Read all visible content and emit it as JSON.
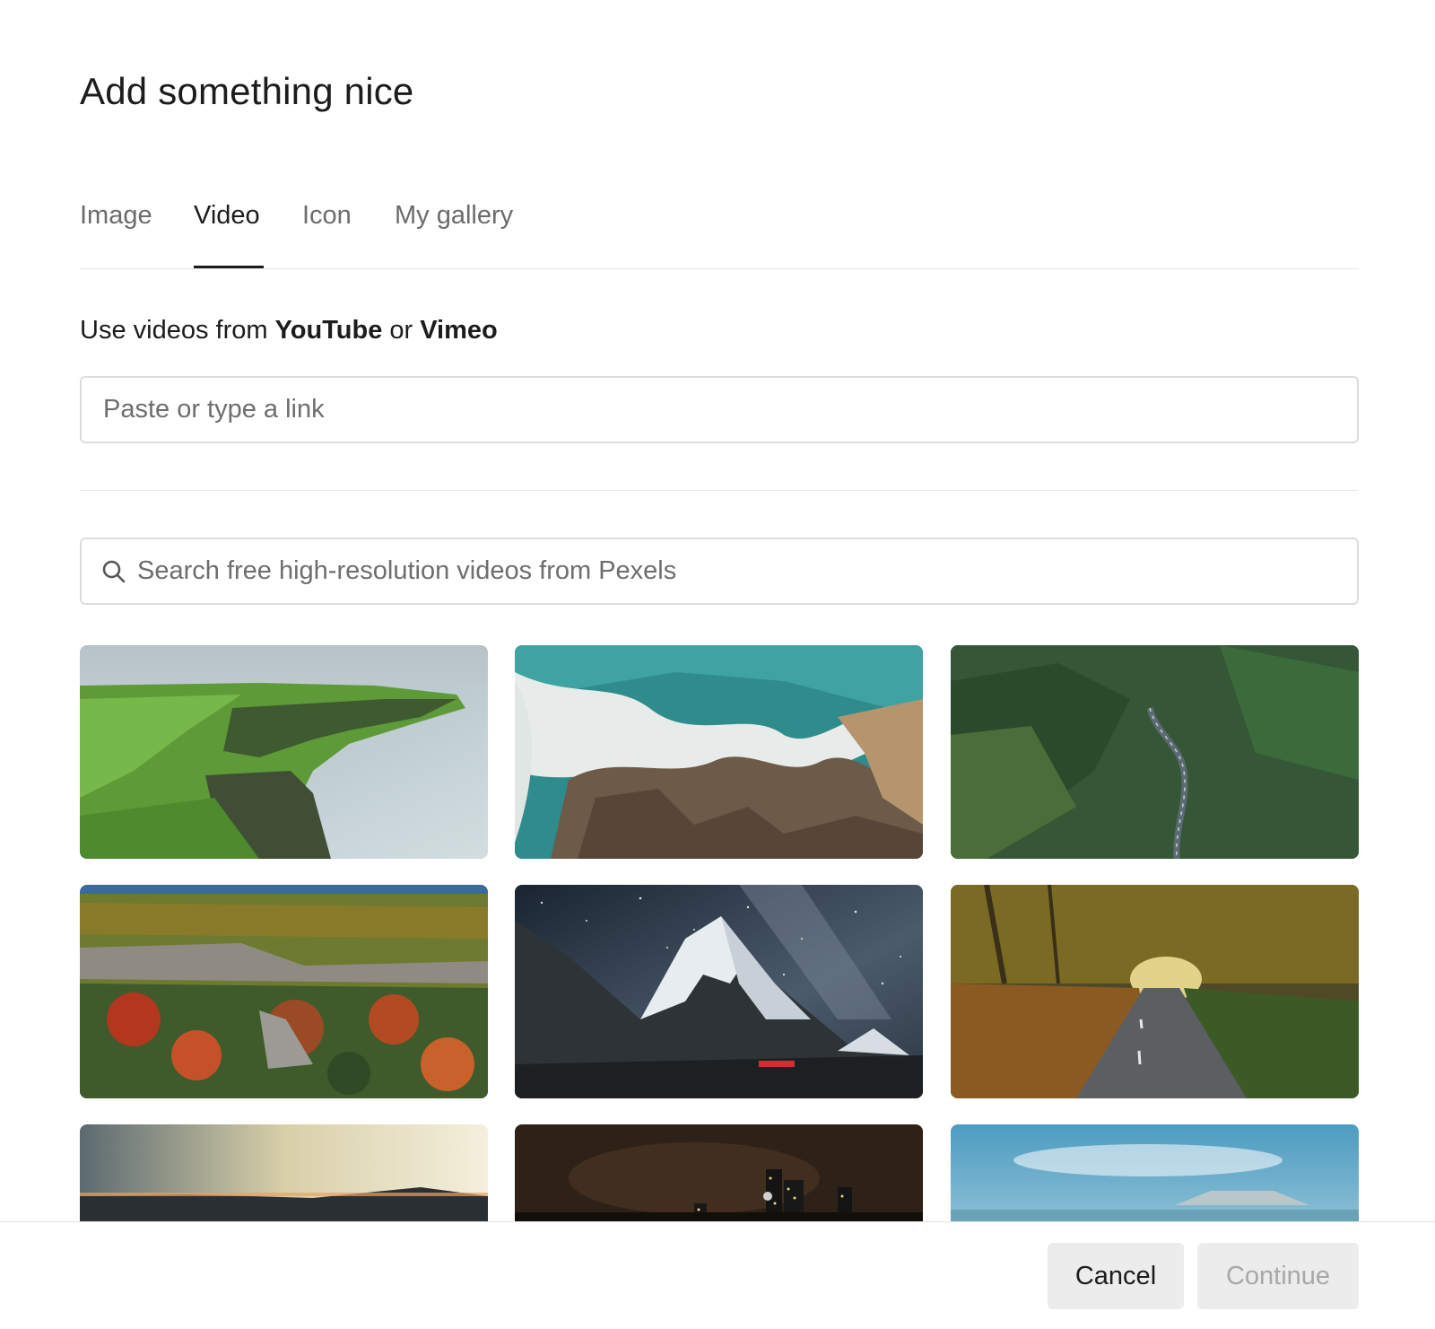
{
  "dialog": {
    "title": "Add something nice"
  },
  "tabs": [
    {
      "label": "Image",
      "active": false
    },
    {
      "label": "Video",
      "active": true
    },
    {
      "label": "Icon",
      "active": false
    },
    {
      "label": "My gallery",
      "active": false
    }
  ],
  "video_source": {
    "prefix": "Use videos from ",
    "source_1": "YouTube",
    "joiner": " or ",
    "source_2": "Vimeo",
    "link_placeholder": "Paste or type a link",
    "link_value": ""
  },
  "search": {
    "placeholder": "Search free high-resolution videos from Pexels",
    "value": ""
  },
  "thumbnails": [
    {
      "subject": "coastal cliffs over the sea"
    },
    {
      "subject": "aerial waves on a rocky shore"
    },
    {
      "subject": "road through dense forest"
    },
    {
      "subject": "autumn forest canyon"
    },
    {
      "subject": "snowy mountain under milky way"
    },
    {
      "subject": "autumn road through trees"
    },
    {
      "subject": "sunset over hills"
    },
    {
      "subject": "city skyline at night"
    },
    {
      "subject": "blue sky over distant mountain"
    }
  ],
  "footer": {
    "cancel_label": "Cancel",
    "continue_label": "Continue",
    "continue_disabled": true
  },
  "colors": {
    "accent": "#1c1c1c",
    "muted_text": "#6b6b6b",
    "button_bg": "#ececec"
  }
}
